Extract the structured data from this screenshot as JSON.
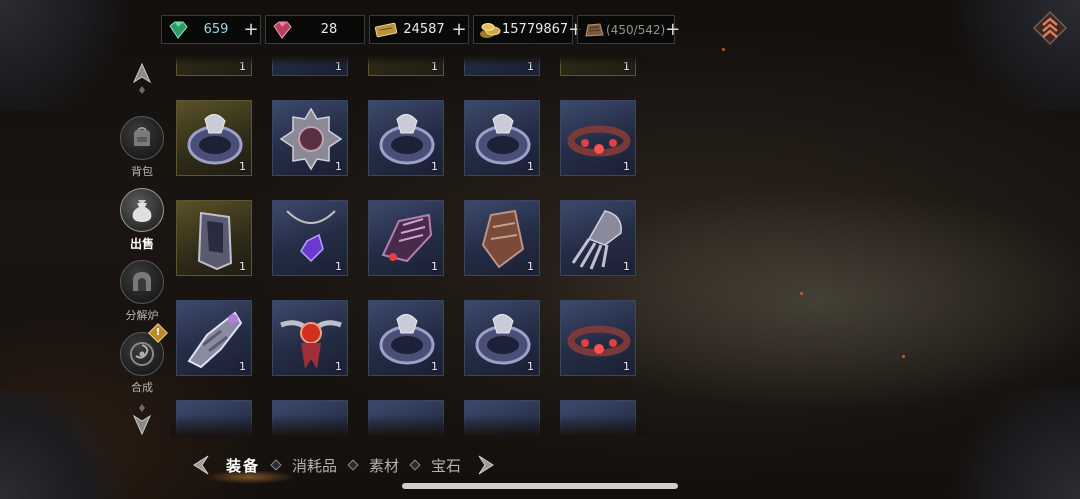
{
  "currencies": [
    {
      "name": "emerald",
      "value": "659",
      "icon": "emerald-gem-icon",
      "color": "#3fb07a"
    },
    {
      "name": "ruby",
      "value": "28",
      "icon": "ruby-gem-icon",
      "color": "#d0587a"
    },
    {
      "name": "ticket",
      "value": "24587",
      "icon": "gold-ticket-icon",
      "color": "#c9a04a"
    },
    {
      "name": "gold",
      "value": "15779867",
      "icon": "gold-coins-icon",
      "color": "#d9b04a"
    },
    {
      "name": "material",
      "value": "(450/542)",
      "icon": "material-pouch-icon",
      "color": "#8a6d48"
    }
  ],
  "nav": {
    "bag": "背包",
    "sell": "出售",
    "decompose": "分解炉",
    "synth": "合成",
    "synth_badge": "!"
  },
  "tabs": {
    "equip": "装备",
    "consumable": "消耗品",
    "material": "素材",
    "gem": "宝石"
  },
  "grid": {
    "rows": [
      [
        {
          "item": "bracelet-icon",
          "qty": "1",
          "frame": "gold"
        },
        {
          "item": "spiked-shield-icon",
          "qty": "1",
          "frame": "blue"
        },
        {
          "item": "bracelet-icon",
          "qty": "1",
          "frame": "blue"
        },
        {
          "item": "bracelet-icon",
          "qty": "1",
          "frame": "blue"
        },
        {
          "item": "ruby-bracelet-icon",
          "qty": "1",
          "frame": "blue"
        }
      ],
      [
        {
          "item": "shin-guard-icon",
          "qty": "1",
          "frame": "gold"
        },
        {
          "item": "amethyst-necklace-icon",
          "qty": "1",
          "frame": "blue"
        },
        {
          "item": "spiked-gauntlet-icon",
          "qty": "1",
          "frame": "blue"
        },
        {
          "item": "leather-bracer-icon",
          "qty": "1",
          "frame": "blue"
        },
        {
          "item": "claw-gauntlet-icon",
          "qty": "1",
          "frame": "blue"
        }
      ],
      [
        {
          "item": "armored-gauntlet-icon",
          "qty": "1",
          "frame": "blue"
        },
        {
          "item": "winged-amulet-icon",
          "qty": "1",
          "frame": "blue"
        },
        {
          "item": "bracelet-icon",
          "qty": "1",
          "frame": "blue"
        },
        {
          "item": "bracelet-icon",
          "qty": "1",
          "frame": "blue"
        },
        {
          "item": "ruby-bracelet-icon",
          "qty": "1",
          "frame": "blue"
        }
      ]
    ],
    "top_partial_qty": [
      "1",
      "1",
      "1",
      "1",
      "1"
    ]
  }
}
